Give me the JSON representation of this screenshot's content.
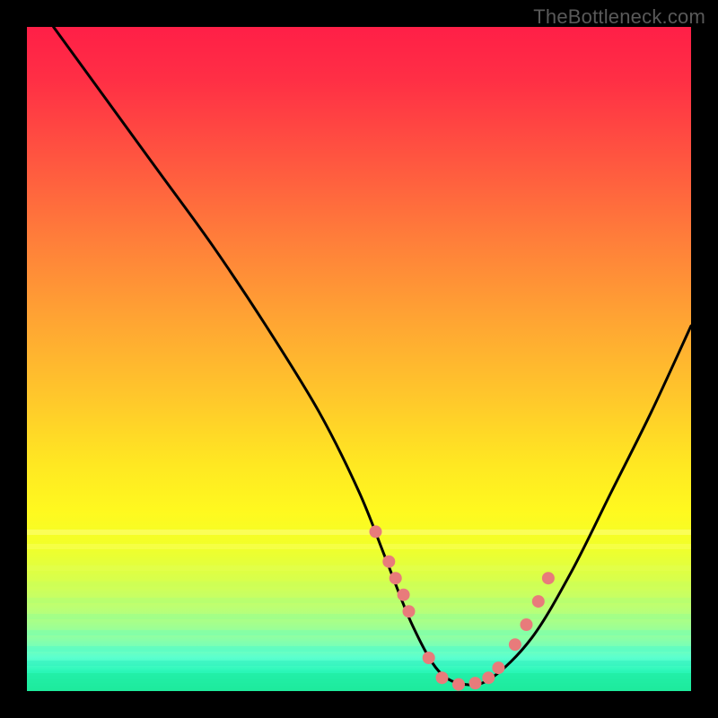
{
  "watermark": "TheBottleneck.com",
  "chart_data": {
    "type": "line",
    "title": "",
    "xlabel": "",
    "ylabel": "",
    "xlim": [
      0,
      100
    ],
    "ylim": [
      0,
      100
    ],
    "curve": {
      "name": "bottleneck-curve",
      "x": [
        4,
        12,
        20,
        28,
        36,
        44,
        50,
        54,
        58,
        62,
        66,
        70,
        76,
        82,
        88,
        94,
        100
      ],
      "y": [
        100,
        89,
        78,
        67,
        55,
        42,
        30,
        20,
        10,
        3,
        1,
        2,
        8,
        18,
        30,
        42,
        55
      ]
    },
    "markers": {
      "name": "highlight-points",
      "color": "#e87b7b",
      "x": [
        52.5,
        54.5,
        55.5,
        56.7,
        57.5,
        60.5,
        62.5,
        65.0,
        67.5,
        69.5,
        71.0,
        73.5,
        75.2,
        77.0,
        78.5
      ],
      "y": [
        24.0,
        19.5,
        17.0,
        14.5,
        12.0,
        5.0,
        2.0,
        1.0,
        1.2,
        2.0,
        3.5,
        7.0,
        10.0,
        13.5,
        17.0
      ]
    },
    "gradient_stops": [
      {
        "pos": 0.0,
        "color": "#ff1f47"
      },
      {
        "pos": 0.5,
        "color": "#ffc82b"
      },
      {
        "pos": 0.76,
        "color": "#fff91f"
      },
      {
        "pos": 1.0,
        "color": "#1de996"
      }
    ]
  }
}
